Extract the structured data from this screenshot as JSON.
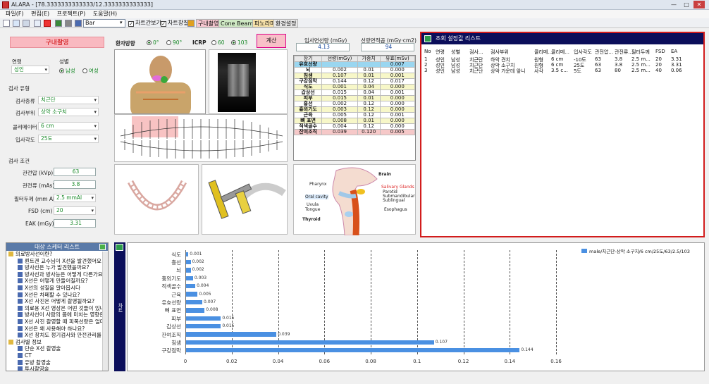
{
  "window": {
    "title": "ALARA - [78.3333333333333/12.3333333333333]",
    "minimize": "—",
    "maximize": "□",
    "close": "✕"
  },
  "menu": [
    "파일(F)",
    "편집(E)",
    "프로젝트(P)",
    "도움말(H)"
  ],
  "toolbar": {
    "combo_value": "Bar",
    "chk_chart": "차트간보기",
    "chk_window": "차트창칠",
    "btn_intraoral": "구내촬영",
    "btn_cbct": "Cone Beam CT",
    "btn_pano": "파노라마",
    "btn_env": "환경설정"
  },
  "left": {
    "mode_title": "구내촬영",
    "age_label": "연령",
    "age_value": "성인",
    "sex_label": "성별",
    "male": "남성",
    "female": "여성",
    "exam_type_label": "검사 유형",
    "exam_kind_label": "검사종류",
    "exam_kind_value": "치근단",
    "exam_site_label": "검사부위",
    "exam_site_value": "상악 소구치",
    "collimator_label": "콜리메이터",
    "collimator_value": "6 cm",
    "angle_label": "입사각도",
    "angle_value": "25도",
    "cond_label": "검사 조건",
    "kvp_label": "관전압 (kVp)",
    "kvp_value": "63",
    "mas_label": "관전류 (mAs)",
    "mas_value": "3.8",
    "filter_label": "필터두께 (mm Al)",
    "filter_value": "2.5 mmAl",
    "fsd_label": "FSD (cm)",
    "fsd_value": "20",
    "eak_label": "EAK (mGy)",
    "eak_value": "3.31"
  },
  "center": {
    "patient_dir_label": "환자방향",
    "dir_0": "0°",
    "dir_90": "90°",
    "icrp_label": "ICRP",
    "icrp_60": "60",
    "icrp_103": "103",
    "calc_button": "계산",
    "entrance_label": "입사면선량 (mGy)",
    "entrance_value": "4.13",
    "dap_label": "선량면적곱 (mGy·cm2)",
    "dap_value": "94"
  },
  "dose_table": {
    "headers": [
      "장기",
      "선량(mGy)",
      "가중치",
      "유효(mSv)"
    ],
    "rows": [
      [
        "유효선량",
        "",
        "",
        "0.007"
      ],
      [
        "뇌",
        "0.002",
        "0.01",
        "0.000"
      ],
      [
        "침샘",
        "0.107",
        "0.01",
        "0.001"
      ],
      [
        "구강점막",
        "0.144",
        "0.12",
        "0.017"
      ],
      [
        "식도",
        "0.001",
        "0.04",
        "0.000"
      ],
      [
        "갑상선",
        "0.015",
        "0.04",
        "0.001"
      ],
      [
        "피부",
        "0.015",
        "0.01",
        "0.000"
      ],
      [
        "흉선",
        "0.002",
        "0.12",
        "0.000"
      ],
      [
        "흉외기도",
        "0.003",
        "0.12",
        "0.000"
      ],
      [
        "근육",
        "0.005",
        "0.12",
        "0.001"
      ],
      [
        "뼈 표면",
        "0.008",
        "0.01",
        "0.000"
      ],
      [
        "적색골수",
        "0.004",
        "0.12",
        "0.000"
      ],
      [
        "잔여조직",
        "0.039",
        "0.120",
        "0.005"
      ]
    ]
  },
  "anatomy": {
    "brain": "Brain",
    "pharynx": "Pharynx",
    "salivary": "Salivary Glands",
    "parotid": "Parotid",
    "submandibular": "Submandibular",
    "sublingual": "Sublingual",
    "oral": "Oral cavity",
    "uvula": "Uvula",
    "tongue": "Tongue",
    "esophagus": "Esophagus",
    "thyroid": "Thyroid"
  },
  "results": {
    "title": "조회 설정값 리스트",
    "headers": [
      "No",
      "연령",
      "성별",
      "검사...",
      "검사부위",
      "콜리메...",
      "콜리메...",
      "입사각도",
      "관전압...",
      "관전류...",
      "필터두께",
      "FSD",
      "EA"
    ],
    "rows": [
      [
        "1",
        "성인",
        "남성",
        "치근단",
        "하악 견치",
        "원형",
        "6 cm",
        "-10도",
        "63",
        "3.8",
        "2.5 m...",
        "20",
        "3.31"
      ],
      [
        "2",
        "성인",
        "남성",
        "치근단",
        "상악 소구치",
        "원형",
        "6 cm",
        "25도",
        "63",
        "3.8",
        "2.5 m...",
        "20",
        "3.31"
      ],
      [
        "3",
        "성인",
        "남성",
        "치근단",
        "상악 가운데 앞니",
        "사각",
        "3.5 c...",
        "5도",
        "63",
        "80",
        "2.5 m...",
        "40",
        "0.06"
      ]
    ]
  },
  "tree": {
    "title": "대상 스케터 리스트",
    "items": [
      {
        "t": "의료방사선이란?",
        "top": true
      },
      {
        "t": "뢴트겐 교수님이 X선을 발견했어요"
      },
      {
        "t": "방사선은 누가 발견했을까요?"
      },
      {
        "t": "방사선과 방사능은 어떻게 다른가요?"
      },
      {
        "t": "X선은 어떻게 만들어질까요?"
      },
      {
        "t": "X선의 성질을 알아봅시다"
      },
      {
        "t": "X선은 차폐할 수 있나요?"
      },
      {
        "t": "X선 사진은 어떻게 촬영될까요?"
      },
      {
        "t": "의료용 X선 영상은 어떤 것들이 있나요?"
      },
      {
        "t": "방사선이 사람의 몸에 미치는 영향은?"
      },
      {
        "t": "X선 사진 촬영할 때 피폭선량은 얼마나"
      },
      {
        "t": "X선은 왜 사용해야 하나요?"
      },
      {
        "t": "X선 장치도 정기검사와 안전관리를 하나"
      },
      {
        "t": "검사별 정보",
        "top": true
      },
      {
        "t": "단순 X선 촬영술"
      },
      {
        "t": "CT"
      },
      {
        "t": "유방 촬영술"
      },
      {
        "t": "투시촬영술"
      },
      {
        "t": "중재적 방사선 시술"
      }
    ]
  },
  "chart_side_label": "차트",
  "chart_data": {
    "type": "bar",
    "orientation": "horizontal",
    "categories": [
      "식도",
      "흉선",
      "뇌",
      "흉외기도",
      "적색골수",
      "근육",
      "유효선량",
      "뼈 표면",
      "피부",
      "갑상선",
      "잔여조직",
      "침샘",
      "구강점막"
    ],
    "series": [
      {
        "name": "male/치근단-상악 소구치/6 cm/25도/63/2.5/103",
        "values": [
          0.001,
          0.002,
          0.002,
          0.003,
          0.004,
          0.005,
          0.007,
          0.008,
          0.015,
          0.015,
          0.039,
          0.107,
          0.144
        ]
      }
    ],
    "value_labels": [
      "0.001",
      "0.002",
      "0.002",
      "0.003",
      "0.004",
      "0.005",
      "0.007",
      "0.008",
      "0.015",
      "0.015",
      "0.039",
      "0.107",
      "0.144"
    ],
    "xticks": [
      "0",
      "0.02",
      "0.04",
      "0.06",
      "0.08",
      "0.1",
      "0.12",
      "0.14",
      "0.16"
    ],
    "xlim": [
      0,
      0.16
    ],
    "grid": true,
    "legend": "top-right",
    "color": "#4a90e2"
  }
}
